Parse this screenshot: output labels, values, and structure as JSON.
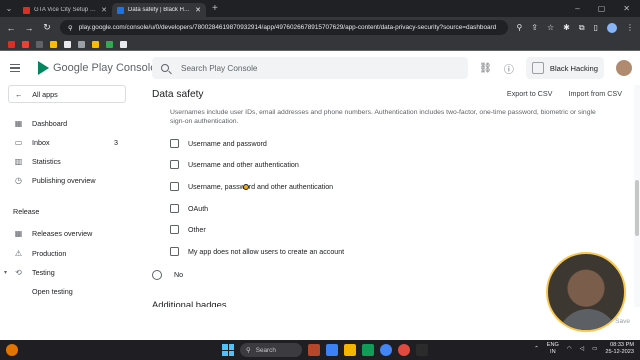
{
  "browser": {
    "tabs": [
      {
        "title": "GTA Vice City Setup Free Dow...",
        "active": false,
        "icon_color": "#d93025"
      },
      {
        "title": "Data safety | Black Hacking",
        "active": true,
        "icon_color": "#1a73e8"
      }
    ],
    "url": "play.google.com/console/u/0/developers/7800284619870932914/app/4976026678915707629/app-content/data-privacy-security?source=dashboard",
    "bookmark_colors": [
      "#d93025",
      "#ea4335",
      "#5f6368",
      "#fbbc04",
      "#e8eaed",
      "#9aa0a6",
      "#fbbc04",
      "#34a853",
      "#e8eaed"
    ]
  },
  "header": {
    "product_name": "Google Play Console",
    "search_placeholder": "Search Play Console",
    "account_name": "Black Hacking"
  },
  "sidebar": {
    "all_apps": "All apps",
    "items": [
      {
        "label": "Dashboard",
        "icon": "dashboard-icon"
      },
      {
        "label": "Inbox",
        "icon": "inbox-icon",
        "count": "3"
      },
      {
        "label": "Statistics",
        "icon": "statistics-icon"
      },
      {
        "label": "Publishing overview",
        "icon": "publishing-icon"
      }
    ],
    "release_section": "Release",
    "release_items": [
      {
        "label": "Releases overview",
        "icon": "releases-icon"
      },
      {
        "label": "Production",
        "icon": "production-icon"
      },
      {
        "label": "Testing",
        "icon": "testing-icon"
      },
      {
        "label": "Open testing"
      }
    ]
  },
  "main": {
    "title": "Data safety",
    "export_csv": "Export to CSV",
    "import_csv": "Import from CSV",
    "description": "Usernames include user IDs, email addresses and phone numbers. Authentication includes two-factor, one-time password, biometric or single sign-on authentication.",
    "options": [
      "Username and password",
      "Username and other authentication",
      "Username, password and other authentication",
      "OAuth",
      "Other",
      "My app does not allow users to create an account"
    ],
    "radio_no": "No",
    "next_section": "Additional badges",
    "save_label": "Save"
  },
  "taskbar": {
    "search": "Search",
    "lang_top": "ENG",
    "lang_bottom": "IN",
    "time": "08:33 PM",
    "date": "25-12-2023"
  }
}
